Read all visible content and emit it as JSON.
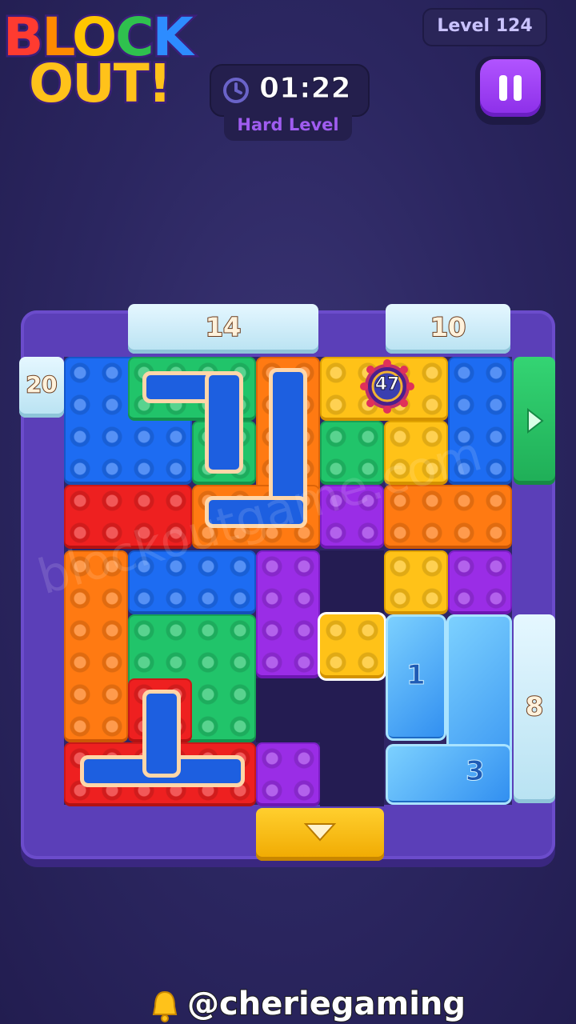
{
  "logo": {
    "line1": [
      "B",
      "L",
      "O",
      "C",
      "K"
    ],
    "line2": "OUT!"
  },
  "header": {
    "timer": "01:22",
    "difficulty": "Hard Level",
    "level": "Level 124"
  },
  "board": {
    "gates": {
      "top_left": "14",
      "top_right": "10",
      "left": "20",
      "right": "8"
    },
    "bomb_counter": "47",
    "ice_piece_a": "1",
    "ice_piece_b": "3",
    "colors": {
      "blue": "#1d6cf2",
      "green": "#21c46a",
      "red": "#ee2020",
      "orange": "#ff7a12",
      "yellow": "#ffc218",
      "purple": "#9a2de6"
    }
  },
  "watermark": "blockoutgame.com",
  "credit": "@cheriegaming",
  "icons": [
    "clock-icon",
    "pause-icon",
    "arrow-right-icon",
    "arrow-down-icon",
    "bell-icon",
    "bomb-icon"
  ]
}
